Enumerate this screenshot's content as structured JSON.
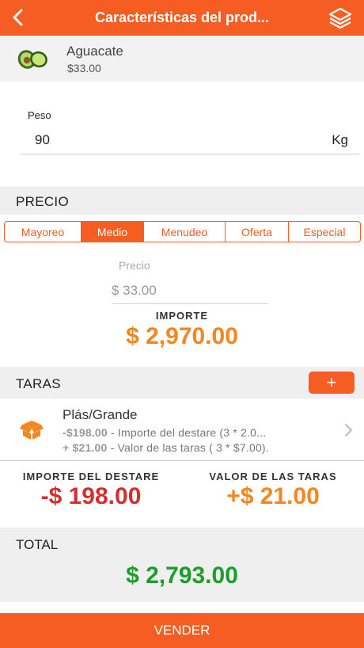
{
  "header": {
    "title": "Características del prod..."
  },
  "product": {
    "name": "Aguacate",
    "price": "$33.00"
  },
  "weight": {
    "label": "Peso",
    "value": "90",
    "unit": "Kg"
  },
  "price_section": {
    "title": "PRECIO",
    "tabs": [
      "Mayoreo",
      "Medio",
      "Menudeo",
      "Oferta",
      "Especial"
    ],
    "active_tab": "Medio",
    "price_label": "Precio",
    "price_value": "$ 33.00",
    "amount_label": "IMPORTE",
    "amount_value": "$ 2,970.00"
  },
  "taras": {
    "title": "TARAS",
    "add_label": "+",
    "items": [
      {
        "name": "Plás/Grande",
        "line1_amount": "-$198.00",
        "line1_text": " - Importe del destare (3 * 2.0...",
        "line2_amount": "+ $21.00",
        "line2_text": " - Valor de las taras ( 3 * $7.00)."
      }
    ]
  },
  "summary": {
    "destare_label": "IMPORTE DEL DESTARE",
    "destare_value": "-$ 198.00",
    "taras_label": "VALOR DE LAS TARAS",
    "taras_value": "+$ 21.00"
  },
  "total": {
    "label": "TOTAL",
    "value": "$ 2,793.00"
  },
  "sell_button": "VENDER",
  "colors": {
    "accent": "#F55D22",
    "amount": "#F7861E",
    "negative": "#D32F2F",
    "total": "#1B9E2B"
  }
}
